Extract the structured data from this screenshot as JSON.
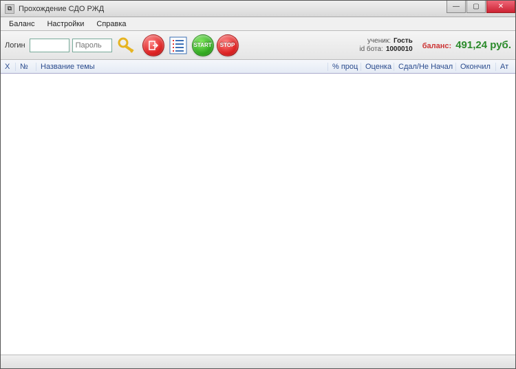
{
  "window": {
    "title": "Прохождение СДО РЖД"
  },
  "menu": {
    "items": [
      "Баланс",
      "Настройки",
      "Справка"
    ]
  },
  "toolbar": {
    "login_label": "Логин",
    "login_value": "",
    "password_label": "Пароль",
    "password_value": "",
    "start_text": "START",
    "stop_text": "STOP"
  },
  "info": {
    "user_label": "ученик:",
    "user_value": "Гость",
    "botid_label": "id бота:",
    "botid_value": "1000010",
    "balance_label": "баланс:",
    "balance_value": "491,24 руб."
  },
  "columns": {
    "x": "Х",
    "num": "№",
    "topic": "Название темы",
    "percent": "% проц",
    "grade": "Оценка",
    "passed": "Сдал/Не Начал",
    "finished": "Окончил",
    "att": "Ат"
  }
}
